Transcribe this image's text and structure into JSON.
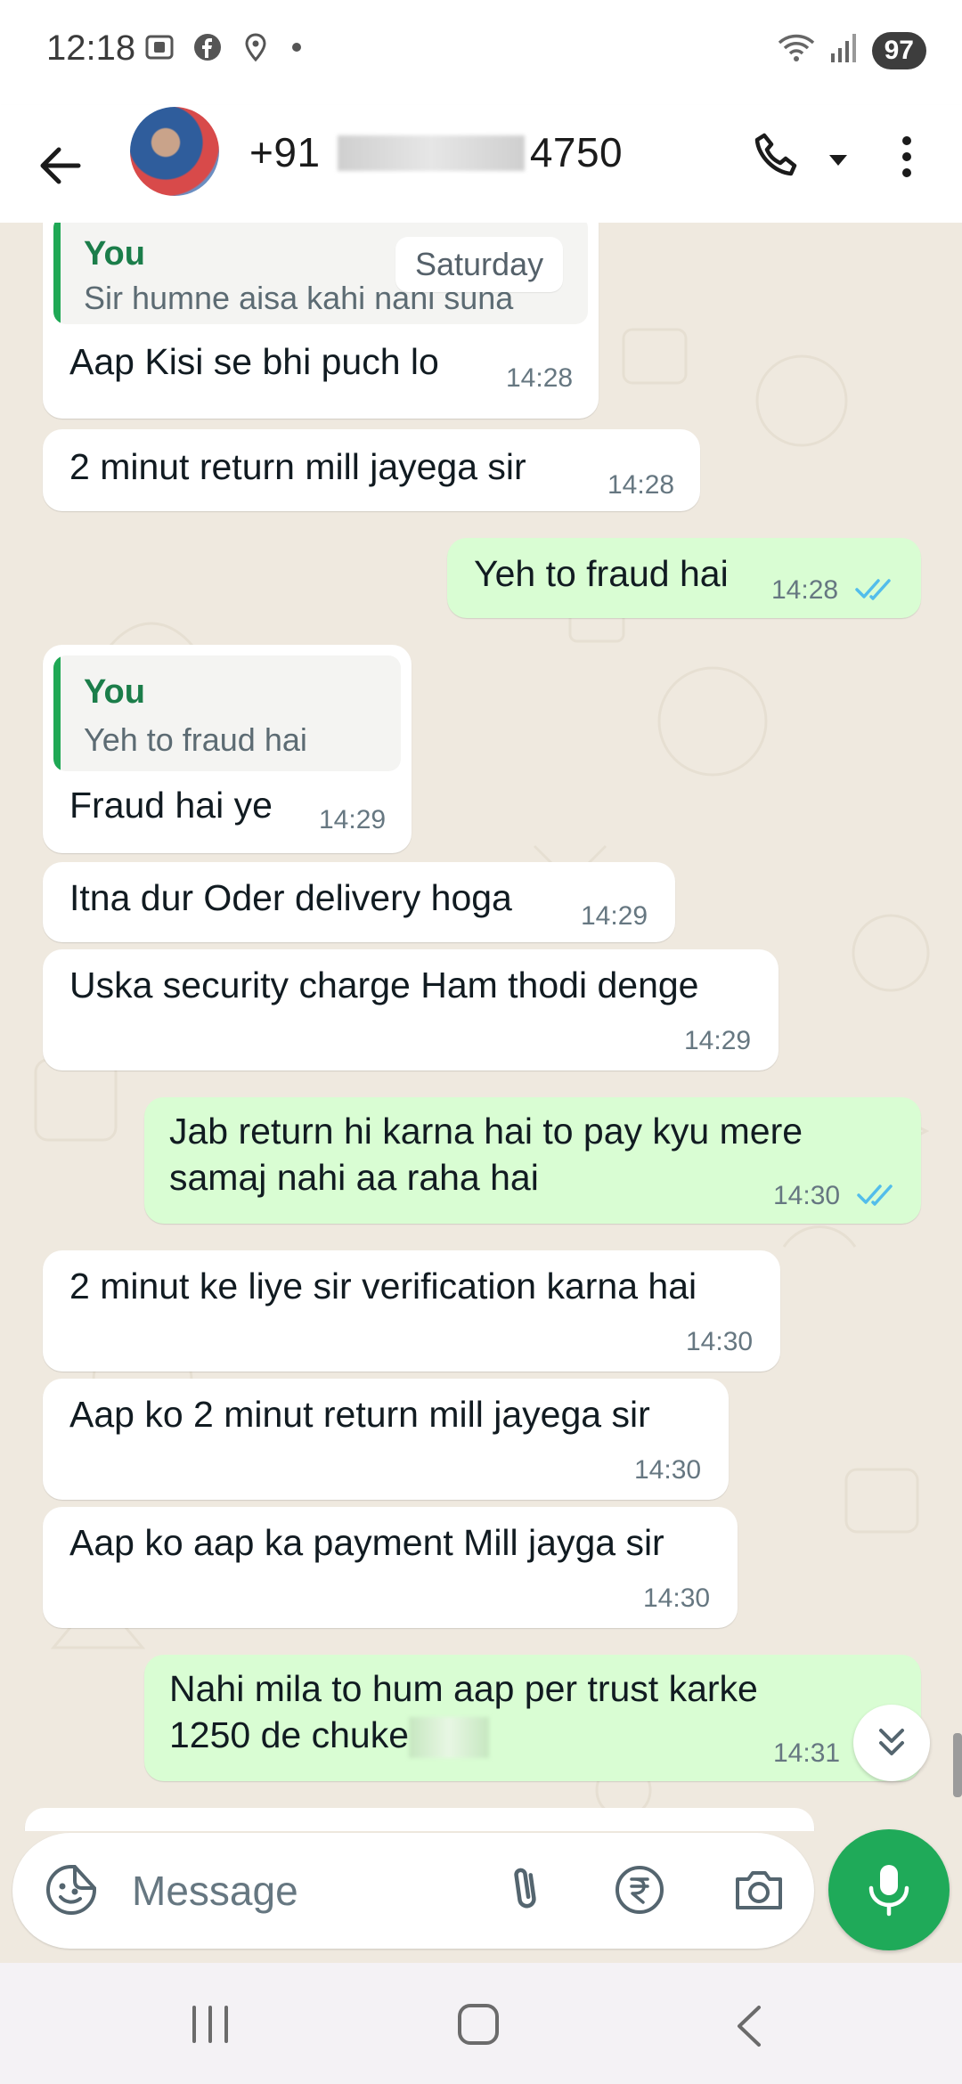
{
  "status_bar": {
    "time": "12:18",
    "battery": "97"
  },
  "header": {
    "contact_prefix": "+91",
    "contact_suffix": "4750"
  },
  "date_chip": "Saturday",
  "messages": [
    {
      "direction": "in",
      "quote_author": "You",
      "quote_text": "Sir humne aisa kahi nahi suna",
      "text": "Aap Kisi se bhi puch lo",
      "time": "14:28"
    },
    {
      "direction": "in",
      "text": "2 minut return mill jayega sir",
      "time": "14:28"
    },
    {
      "direction": "out",
      "text": "Yeh to fraud hai",
      "time": "14:28",
      "status": "read"
    },
    {
      "direction": "in",
      "quote_author": "You",
      "quote_text": "Yeh to fraud hai",
      "text": "Fraud hai ye",
      "time": "14:29"
    },
    {
      "direction": "in",
      "text": "Itna dur Oder delivery hoga",
      "time": "14:29"
    },
    {
      "direction": "in",
      "text": "Uska security charge Ham thodi denge",
      "time": "14:29"
    },
    {
      "direction": "out",
      "text_line1": "Jab return hi karna hai to pay kyu mere",
      "text_line2": "samaj nahi aa raha hai",
      "time": "14:30",
      "status": "read"
    },
    {
      "direction": "in",
      "text": "2 minut ke liye sir verification karna hai",
      "time": "14:30"
    },
    {
      "direction": "in",
      "text": "Aap ko 2 minut return mill jayega sir",
      "time": "14:30"
    },
    {
      "direction": "in",
      "text": "Aap ko aap ka payment Mill jayga sir",
      "time": "14:30"
    },
    {
      "direction": "out",
      "text_line1": "Nahi mila to hum aap per trust karke",
      "text_line2": "1250 de chuke",
      "time": "14:31",
      "status": "read"
    }
  ],
  "input": {
    "placeholder": "Message"
  },
  "icons": {
    "back": "arrow-left-icon",
    "call": "phone-icon",
    "more": "more-vertical-icon",
    "emoji": "sticker-icon",
    "attach": "paperclip-icon",
    "payment": "rupee-icon",
    "camera": "camera-icon",
    "mic": "mic-icon"
  },
  "colors": {
    "incoming": "#ffffff",
    "outgoing": "#d9fdd3",
    "accent": "#1faa59",
    "read_ticks": "#53bdeb"
  }
}
